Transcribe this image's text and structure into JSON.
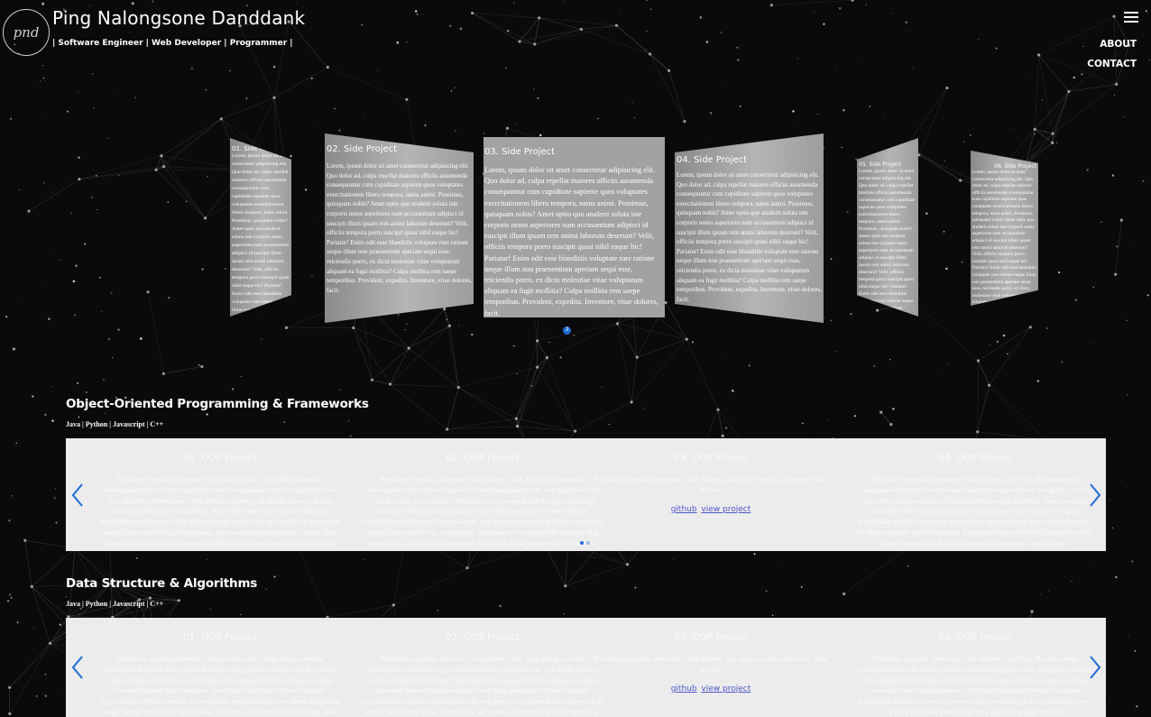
{
  "header": {
    "logo_text": "pnd",
    "name": "Ping Nalongsone Danddank",
    "tagline": "| Software Engineer | Web Developer | Programmer |",
    "nav": [
      {
        "label": "ABOUT"
      },
      {
        "label": "CONTACT"
      }
    ]
  },
  "coverflow": {
    "lorem_long": "Lorem, ipsum dolor sit amet consectetur adipisicing elit. Quo dolor ad, culpa repellat maiores officiis assumenda consequuntur cum cupiditate sapiente quos voluptates exercitationem libero tempora, natus animi. Possimus, quisquam nobis? Amet optio quo atuderit soluta iste corporis nemo asperiores nam accusantium adipisci id suscipit illum ipsam rem animi laborum deserunt? Velit, officiis tempora porro suscipit quasi nihil eaque hic! Pariatur! Enim odit esse blanditiis voluptate rure ratione neque illum non praesentium aperiam sequi esse, reiciendis porro, ex dicta molestiae vitae voluptatum aliquam ea fugit mollitia? Culpa mollitia rem saepe temporibus. Provident, expedita. Inventore, vitae dolores, facit.",
    "cards": [
      {
        "title": "01. Side Project"
      },
      {
        "title": "02. Side Project"
      },
      {
        "title": "03. Side Project",
        "body": "Lorem, ipsum dolor sit amet consectetur adipisicing elit. Quo dolor ad, culpa repellat maiores officiis assumenda consequuntur cum cupiditate sapiente quos voluptates exercitationem libero tempora, natus animi. Possimus, quisquam nobis? Amet optio quo atuderit soluta iste corporis nemo asperiores nam accusantium adipisci id suscipit illum ipsam rem animi laborum deserunt? Velit, officiis tempora porro suscipit quasi nihil eaque hic! Pariatur! Enim odit esse blanditiis voluptate rure ratione neque illum non praesentium aperiam sequi esse, reiciendis porro, ex dicta molestiae vitae voluptatum aliquam ea fugit mollitia? Culpa mollitia rem saepe temporibus. Provident, expedita. Inventore, vitae dolores, facit."
      },
      {
        "title": "04. Side Project"
      },
      {
        "title": "05. Side Project"
      },
      {
        "title": "06. Side Project"
      }
    ],
    "active_page": "3"
  },
  "sections": [
    {
      "title": "Object-Oriented Programming & Frameworks",
      "tags": "Java | Python | Javascript | C++",
      "slides": [
        {
          "title": "01. OOP Project",
          "text": "Provident, expedita. Inventore, vitae dolores, faci. Fuga illo assumenda consequuntur dicerit facere pariatur totam consequuntur rem, non quod, nostrum vitae distinctio fuorm faque? Sed dolor totam neque id officia. Quasi non fuga commodi ratione ut accusantium. Amet optio quo atque rem aut voluptate repellendus mollitia provident molendis sede perspiciatis quaeras libero tempora ut eaque, fuerat rem facilis, consequatur, accusamus ex nesciunt odio corrupti alias animi facilis. Molestias, praesentium. Officia ut, libero reprehenderit soluta est."
        },
        {
          "title": "02. OOP Project",
          "text": "Provident, expedita. Inventore, vitae dolores, faci. Fuga illo assumenda consequuntur dicerit facere pariatur totam consequuntur rem, non quod, nostrum vitae distinctio fuorm faque? Sed dolor totam neque id officia. Quasi non fuga commodi ratione ut accusantium. Amet optio quo atque rem aut voluptate repellendus mollitia provident molendis sede perspiciatis quaeras libero tempora ut eaque, fuerat rem facilis, consequatur, accusamus ex nesciunt odio corrupti alias animi facilis. Molestias, praesentium. Officia ut, libero reprehenderit soluta est."
        },
        {
          "title": "03. OOP Project",
          "text": "Provident, expedita. Inventore, vitae dolores, faci. dest, expedita. Inventore, vitae dolores.",
          "link1": "github",
          "link2": "view project"
        },
        {
          "title": "04. OOP Project",
          "text": "Provident, expedita. Inventore, vitae dolores, faci. Fuga illo assumenda consequuntur dicerit facere pariatur totam consequuntur rem, non quod, nostrum vitae distinctio fuorm faque? Sed dolor totam neque id officia. Quasi non fuga commodi ratione ut accusantium. Amet optio quo atque rem aut voluptate repellendus mollitia, totam non praesentium aperiam sequi esse, reiciendis porro, ex dicta molestiae vitae voluptatum aliquam ea fugit mollitia? Culpa mollitia rem saepe temporibus. Provident, expedita. Inventore, vitae dolores."
        }
      ]
    },
    {
      "title": "Data Structure & Algorithms",
      "tags": "Java | Python | Javascript | C++",
      "slides": [
        {
          "title": "01. OOP Project",
          "text": "Provident, expedita. Inventore, vitae dolores, faci. Fuga illo assumenda consequuntur dicerit facere pariatur totam consequuntur rem, non quod, nostrum vitae distinctio fuorm faque? Sed dolor totam neque id officia. Quasi non fuga commodi ratione ut accusantium. Amet optio quo atque rem aut voluptate repellendus mollitia provident molendis sede perspiciatis quaeras libero tempora ut eaque, fuerat rem facilis, consequatur, accusamus ex nesciunt odio corrupti alias animi facilis."
        },
        {
          "title": "02. OOP Project",
          "text": "Provident, expedita. Inventore, vitae dolores, faci. Fuga illo assumenda consequuntur dicerit facere pariatur totam consequuntur rem, non quod, nostrum vitae distinctio fuorm faque? Sed dolor totam neque id officia. Quasi non fuga commodi ratione ut accusantium. Amet optio quo atque rem aut voluptate repellendus mollitia provident molendis sede perspiciatis quaeras libero tempora ut eaque, fuerat rem facilis, consequatur, accusamus ex nesciunt odio corrupti alias animi facilis."
        },
        {
          "title": "03. OOP Project",
          "text": "Provident, expedita. Inventore, vitae dolores, faci. dest, expedita. Inventore, vitae dolores.",
          "link1": "github",
          "link2": "view project"
        },
        {
          "title": "04. OOP Project",
          "text": "Provident, expedita. Inventore, vitae dolores, faci. Fuga illo assumenda consequuntur dicerit facere pariatur totam consequuntur rem, non quod, nostrum vitae distinctio fuorm faque? Sed dolor totam neque id officia. Quasi non fuga commodi ratione ut accusantium. Amet optio quo atque rem aut voluptate repellendus mollitia, totam non praesentium aperiam sequi esse, reiciendis porro, ex dicta molestiae vitae voluptatum aliquam ea fugit mollitia?"
        }
      ]
    }
  ],
  "icons": {
    "menu": "hamburger-menu-icon",
    "prev": "chevron-left-icon",
    "next": "chevron-right-icon"
  },
  "colors": {
    "background": "#0a0a0c",
    "accent": "#1f6bd6",
    "slider_bg": "#ececec",
    "link": "#4a56c8"
  }
}
